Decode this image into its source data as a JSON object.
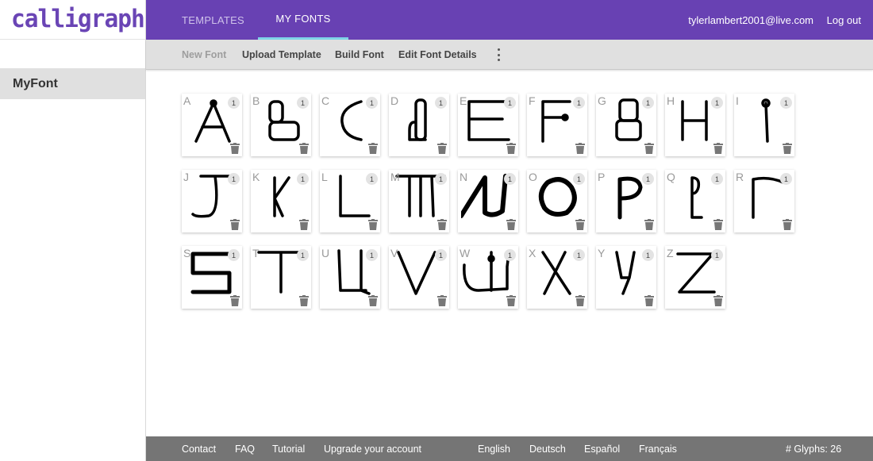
{
  "brand": {
    "logo_text": "calligraphr",
    "color": "#6a45b5"
  },
  "topnav": {
    "tabs": [
      {
        "label": "TEMPLATES",
        "active": false
      },
      {
        "label": "MY FONTS",
        "active": true
      }
    ],
    "user_email": "tylerlambert2001@live.com",
    "logout_label": "Log out",
    "bg_color": "#6841b3"
  },
  "toolbar": {
    "new_font": "New Font",
    "upload_template": "Upload Template",
    "build_font": "Build Font",
    "edit_font_details": "Edit Font Details",
    "more_icon": "more-vertical-icon"
  },
  "sidebar": {
    "fonts": [
      {
        "label": "MyFont",
        "selected": true
      }
    ]
  },
  "glyphs": [
    {
      "char": "A",
      "count": "1"
    },
    {
      "char": "B",
      "count": "1"
    },
    {
      "char": "C",
      "count": "1"
    },
    {
      "char": "D",
      "count": "1"
    },
    {
      "char": "E",
      "count": "1"
    },
    {
      "char": "F",
      "count": "1"
    },
    {
      "char": "G",
      "count": "1"
    },
    {
      "char": "H",
      "count": "1"
    },
    {
      "char": "I",
      "count": "1"
    },
    {
      "char": "J",
      "count": "1"
    },
    {
      "char": "K",
      "count": "1"
    },
    {
      "char": "L",
      "count": "1"
    },
    {
      "char": "M",
      "count": "1"
    },
    {
      "char": "N",
      "count": "1"
    },
    {
      "char": "O",
      "count": "1"
    },
    {
      "char": "P",
      "count": "1"
    },
    {
      "char": "Q",
      "count": "1"
    },
    {
      "char": "R",
      "count": "1"
    },
    {
      "char": "S",
      "count": "1"
    },
    {
      "char": "T",
      "count": "1"
    },
    {
      "char": "U",
      "count": "1"
    },
    {
      "char": "V",
      "count": "1"
    },
    {
      "char": "W",
      "count": "1"
    },
    {
      "char": "X",
      "count": "1"
    },
    {
      "char": "Y",
      "count": "1"
    },
    {
      "char": "Z",
      "count": "1"
    }
  ],
  "footer": {
    "contact": "Contact",
    "faq": "FAQ",
    "tutorial": "Tutorial",
    "upgrade": "Upgrade your account",
    "languages": [
      "English",
      "Deutsch",
      "Español",
      "Français"
    ],
    "glyph_count": "# Glyphs: 26"
  }
}
